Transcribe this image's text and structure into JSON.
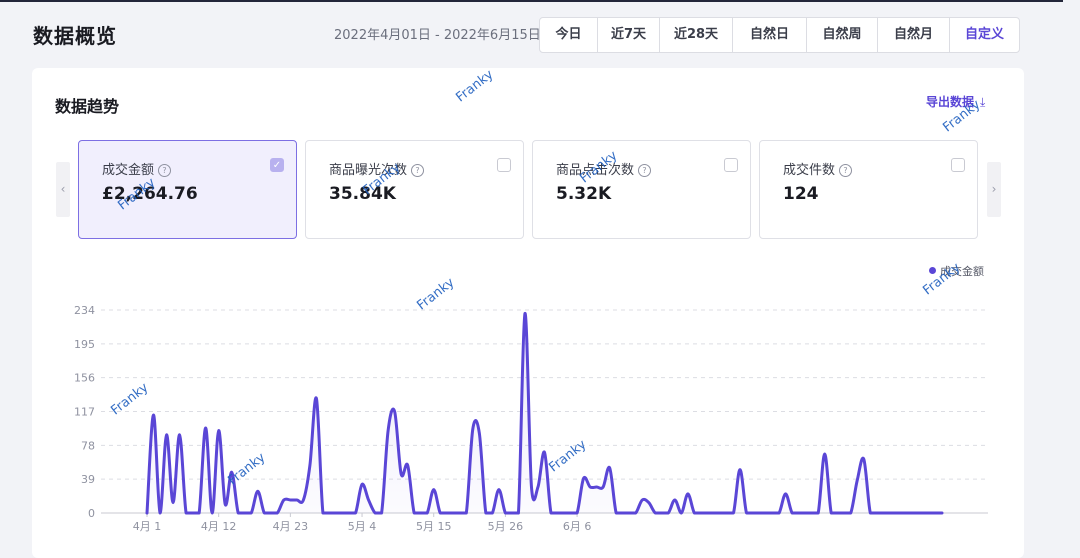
{
  "header": {
    "title": "数据概览",
    "date_range": "2022年4月01日 - 2022年6月15日",
    "tabs": [
      {
        "label": "今日",
        "active": false
      },
      {
        "label": "近7天",
        "active": false
      },
      {
        "label": "近28天",
        "active": false
      },
      {
        "label": "自然日",
        "active": false
      },
      {
        "label": "自然周",
        "active": false
      },
      {
        "label": "自然月",
        "active": false
      },
      {
        "label": "自定义",
        "active": true
      }
    ]
  },
  "panel": {
    "title": "数据趋势",
    "export_label": "导出数据",
    "export_icon": "download-icon",
    "prev_arrow": "‹",
    "next_arrow": "›"
  },
  "metrics": [
    {
      "label": "成交金额",
      "value": "£2,264.76",
      "checked": true
    },
    {
      "label": "商品曝光次数",
      "value": "35.84K",
      "checked": false
    },
    {
      "label": "商品点击次数",
      "value": "5.32K",
      "checked": false
    },
    {
      "label": "成交件数",
      "value": "124",
      "checked": false
    }
  ],
  "watermark": "Franky",
  "colors": {
    "accent": "#5a46d6",
    "selected_bg": "#f1effd",
    "grid": "#dcdde3"
  },
  "chart_data": {
    "type": "line",
    "series": [
      {
        "name": "成交金额",
        "values": [
          0,
          113,
          0,
          90,
          12,
          90,
          0,
          0,
          0,
          98,
          0,
          95,
          10,
          47,
          0,
          0,
          0,
          25,
          0,
          0,
          0,
          15,
          15,
          15,
          15,
          55,
          132,
          0,
          0,
          0,
          0,
          0,
          0,
          33,
          15,
          0,
          0,
          95,
          117,
          45,
          55,
          0,
          0,
          0,
          27,
          0,
          0,
          0,
          0,
          0,
          97,
          92,
          0,
          0,
          27,
          0,
          0,
          0,
          230,
          30,
          30,
          70,
          0,
          0,
          0,
          0,
          0,
          40,
          30,
          30,
          30,
          52,
          0,
          0,
          0,
          0,
          15,
          12,
          0,
          0,
          0,
          15,
          0,
          22,
          0,
          0,
          0,
          0,
          0,
          0,
          0,
          50,
          0,
          0,
          0,
          0,
          0,
          0,
          22,
          0,
          0,
          0,
          0,
          0,
          68,
          0,
          0,
          0,
          0,
          38,
          62,
          0,
          0,
          0,
          0,
          0,
          0,
          0,
          0,
          0,
          0,
          0,
          0
        ]
      }
    ],
    "x_ticks": [
      "4月 1",
      "4月 12",
      "4月 23",
      "5月 4",
      "5月 15",
      "5月 26",
      "6月 6"
    ],
    "y_ticks": [
      0,
      39,
      78,
      117,
      156,
      195,
      234
    ],
    "ylim": [
      0,
      234
    ],
    "grid": true,
    "legend_position": "top-right"
  }
}
